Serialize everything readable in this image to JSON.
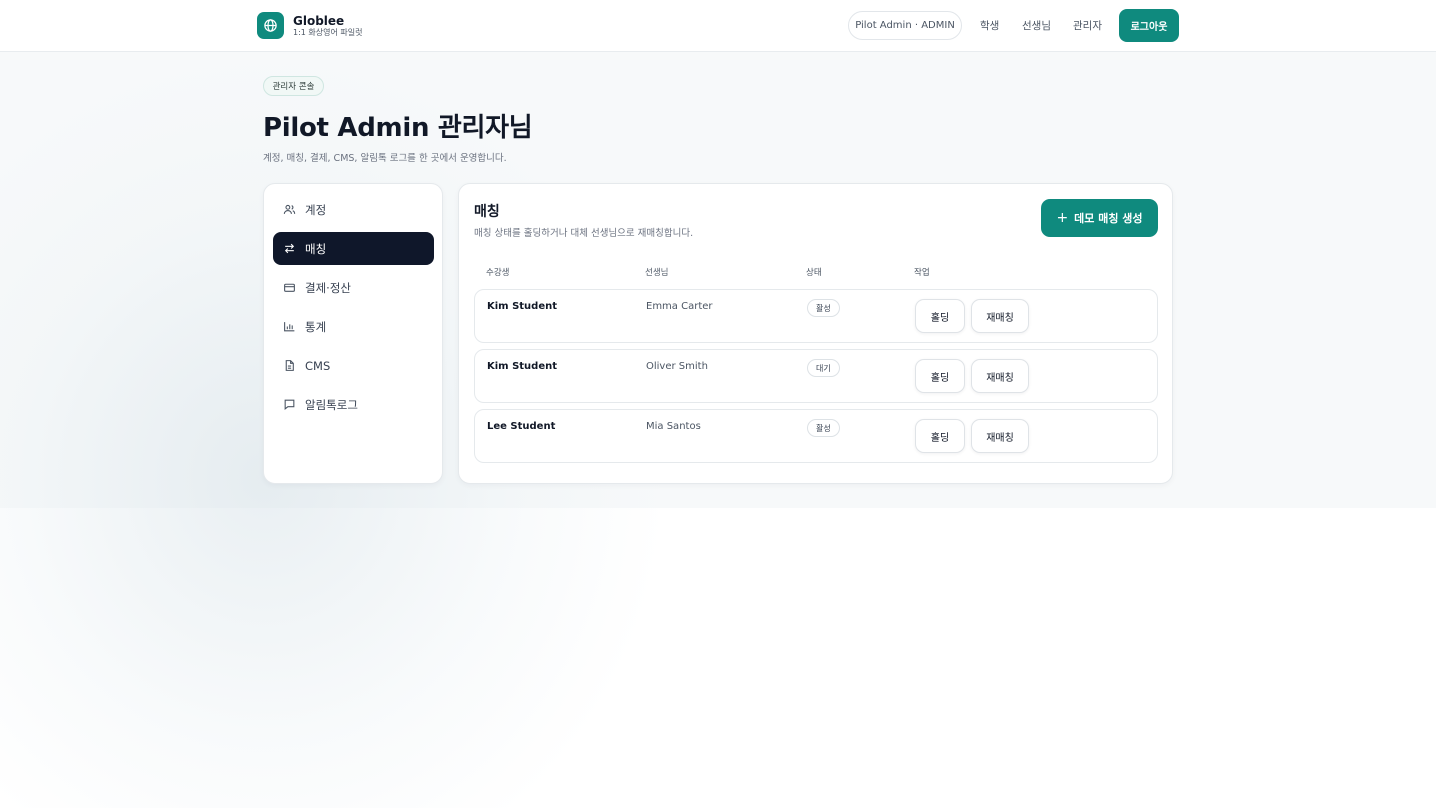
{
  "header": {
    "brand_name": "Globlee",
    "brand_sub": "1:1 화상영어 파일럿",
    "user_pill": "Pilot Admin · ADMIN",
    "nav": [
      "학생",
      "선생님",
      "관리자"
    ],
    "logout_label": "로그아웃"
  },
  "hero": {
    "badge": "관리자 콘솔",
    "title": "Pilot Admin 관리자님",
    "description": "계정, 매칭, 결제, CMS, 알림톡 로그를 한 곳에서 운영합니다."
  },
  "sidebar": {
    "items": [
      {
        "label": "계정",
        "icon": "users-icon",
        "active": false
      },
      {
        "label": "매칭",
        "icon": "swap-arrows-icon",
        "active": true
      },
      {
        "label": "결제·정산",
        "icon": "credit-card-icon",
        "active": false
      },
      {
        "label": "통계",
        "icon": "bar-chart-icon",
        "active": false
      },
      {
        "label": "CMS",
        "icon": "document-icon",
        "active": false
      },
      {
        "label": "알림톡로그",
        "icon": "chat-bubble-icon",
        "active": false
      }
    ]
  },
  "main": {
    "title": "매칭",
    "description": "매칭 상태를 홀딩하거나 대체 선생님으로 재매칭합니다.",
    "create_label": "데모 매칭 생성",
    "columns": [
      "수강생",
      "선생님",
      "상태",
      "작업"
    ],
    "rows": [
      {
        "student": "Kim Student",
        "tutor": "Emma Carter",
        "status": "활성",
        "hold": "홀딩",
        "rematch": "재매칭"
      },
      {
        "student": "Kim Student",
        "tutor": "Oliver Smith",
        "status": "대기",
        "hold": "홀딩",
        "rematch": "재매칭"
      },
      {
        "student": "Lee Student",
        "tutor": "Mia Santos",
        "status": "활성",
        "hold": "홀딩",
        "rematch": "재매칭"
      }
    ]
  },
  "colors": {
    "accent": "#0f8a7e",
    "active_nav": "#0f172a"
  }
}
